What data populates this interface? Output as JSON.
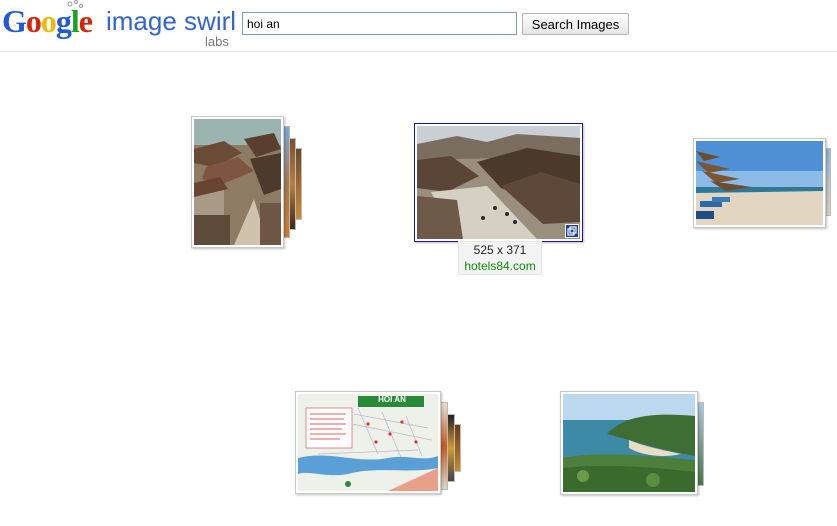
{
  "header": {
    "logo_letters": [
      "G",
      "o",
      "o",
      "g",
      "l",
      "e"
    ],
    "product_name": "image swirl",
    "labs": "labs",
    "search_value": "hoi an",
    "search_button": "Search Images"
  },
  "selected_image": {
    "dimensions": "525 x 371",
    "domain": "hotels84.com"
  },
  "map_image": {
    "title": "HOI AN"
  },
  "colors": {
    "logo_blue": "#2159d6",
    "logo_red": "#d62408",
    "logo_yellow": "#efba00",
    "logo_green": "#18a221",
    "product_blue": "#3366cc",
    "selected_border": "#1a1a8a",
    "domain_green": "#0a8a0a"
  },
  "icons": [
    "flask-icon",
    "expand-icon"
  ]
}
